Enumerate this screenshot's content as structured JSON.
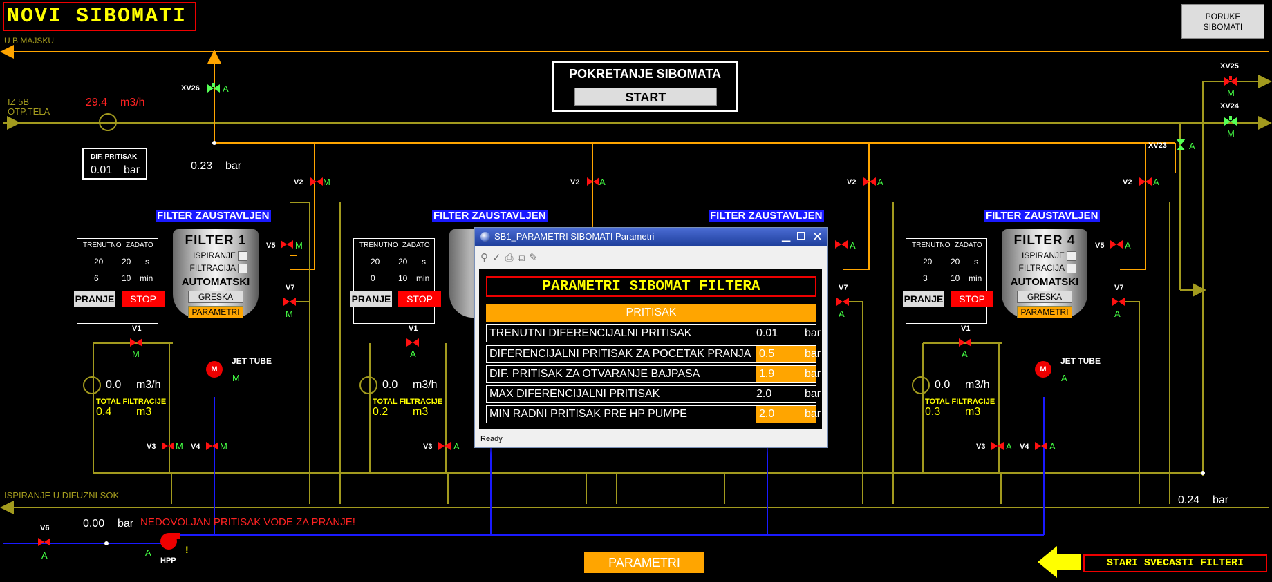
{
  "title": "NOVI SIBOMATI",
  "poruke_button": "PORUKE\nSIBOMATI",
  "labels": {
    "to_majsku": "U B MAJSKU",
    "from_5b_1": "IZ 5B",
    "from_5b_2": "OTP.TELA",
    "ispiranje": "ISPIRANJE U DIFUZNI SOK",
    "nedovoljan": "NEDOVOLJAN PRITISAK VODE ZA PRANJE!",
    "hpp": "HPP",
    "hpp_state": "A",
    "hpp_warn": "!",
    "stari": "STARI SVECASTI FILTERI",
    "parametri_bottom": "PARAMETRI"
  },
  "inlet": {
    "flow_value": "29.4",
    "flow_unit": "m3/h"
  },
  "dif_pritisak": {
    "label": "DIF. PRITISAK",
    "value": "0.01",
    "unit": "bar"
  },
  "pressures": {
    "top": {
      "value": "0.23",
      "unit": "bar"
    },
    "right": {
      "value": "0.24",
      "unit": "bar"
    },
    "bottom": {
      "value": "0.00",
      "unit": "bar"
    }
  },
  "start_panel": {
    "title": "POKRETANJE SIBOMATA",
    "button": "START"
  },
  "valves_global": {
    "xv26": {
      "name": "XV26",
      "state": "A"
    },
    "xv25": {
      "name": "XV25",
      "state": "M"
    },
    "xv24": {
      "name": "XV24",
      "state": "M"
    },
    "xv23": {
      "name": "XV23",
      "state": "A"
    },
    "v6": {
      "name": "V6",
      "state": "A"
    }
  },
  "filters": [
    {
      "status": "FILTER ZAUSTAVLJEN",
      "name": "FILTER 1",
      "mode": "AUTOMATSKI",
      "ispiranje": "ISPIRANJE",
      "filtracija": "FILTRACIJA",
      "greska": "GRESKA",
      "parametri": "PARAMETRI",
      "table": {
        "h1": "TRENUTNO",
        "h2": "ZADATO",
        "r1c1": "20",
        "r1c2": "20",
        "r1u": "s",
        "r2c1": "6",
        "r2c2": "10",
        "r2u": "min"
      },
      "pranje": "PRANJE",
      "stop": "STOP",
      "flow_value": "0.0",
      "flow_unit": "m3/h",
      "total_label": "TOTAL FILTRACIJE",
      "total_value": "0.4",
      "total_unit": "m3",
      "jet": "JET TUBE",
      "motor": "M",
      "motor_state": "M",
      "v1": "M",
      "v2": "M",
      "v3": "M",
      "v4": "M",
      "v5": "M",
      "v7": "M"
    },
    {
      "status": "FILTER ZAUSTAVLJEN",
      "table": {
        "h1": "TRENUTNO",
        "h2": "ZADATO",
        "r1c1": "20",
        "r1c2": "20",
        "r1u": "s",
        "r2c1": "0",
        "r2c2": "10",
        "r2u": "min"
      },
      "pranje": "PRANJE",
      "stop": "STOP",
      "flow_value": "0.0",
      "flow_unit": "m3/h",
      "total_label": "TOTAL FILTRACIJE",
      "total_value": "0.2",
      "total_unit": "m3",
      "v1": "A",
      "v2": "A",
      "v3": "A"
    },
    {
      "status": "FILTER ZAUSTAVLJEN",
      "v2": "A",
      "v5": "A",
      "v7": "A"
    },
    {
      "status": "FILTER ZAUSTAVLJEN",
      "name": "FILTER 4",
      "mode": "AUTOMATSKI",
      "ispiranje": "ISPIRANJE",
      "filtracija": "FILTRACIJA",
      "greska": "GRESKA",
      "parametri": "PARAMETRI",
      "table": {
        "h1": "TRENUTNO",
        "h2": "ZADATO",
        "r1c1": "20",
        "r1c2": "20",
        "r1u": "s",
        "r2c1": "3",
        "r2c2": "10",
        "r2u": "min"
      },
      "pranje": "PRANJE",
      "stop": "STOP",
      "flow_value": "0.0",
      "flow_unit": "m3/h",
      "total_label": "TOTAL FILTRACIJE",
      "total_value": "0.3",
      "total_unit": "m3",
      "jet": "JET TUBE",
      "motor": "M",
      "motor_state": "A",
      "v1": "A",
      "v2": "A",
      "v3": "A",
      "v4": "A",
      "v5": "A",
      "v7": "A"
    }
  ],
  "valve_names": {
    "v1": "V1",
    "v2": "V2",
    "v3": "V3",
    "v4": "V4",
    "v5": "V5",
    "v7": "V7"
  },
  "dialog": {
    "title": "SB1_PARAMETRI SIBOMATI Parametri",
    "heading": "PARAMETRI SIBOMAT FILTERA",
    "section": "PRITISAK",
    "rows": [
      {
        "label": "TRENUTNI DIFERENCIJALNI PRITISAK",
        "value": "0.01",
        "unit": "bar"
      },
      {
        "label": "DIFERENCIJALNI PRITISAK ZA POCETAK PRANJA",
        "value": "0.5",
        "unit": "bar"
      },
      {
        "label": "DIF. PRITISAK ZA OTVARANJE BAJPASA",
        "value": "1.9",
        "unit": "bar"
      },
      {
        "label": "MAX DIFERENCIJALNI PRITISAK",
        "value": "2.0",
        "unit": "bar"
      },
      {
        "label": "MIN RADNI PRITISAK PRE HP PUMPE",
        "value": "2.0",
        "unit": "bar"
      }
    ],
    "status": "Ready"
  },
  "colors": {
    "pipe_olive": "#a29a1e",
    "pipe_orange": "#ffa500",
    "pipe_blue": "#1a1aff",
    "valve_red": "#ff1a1a",
    "valve_green": "#5f5"
  }
}
